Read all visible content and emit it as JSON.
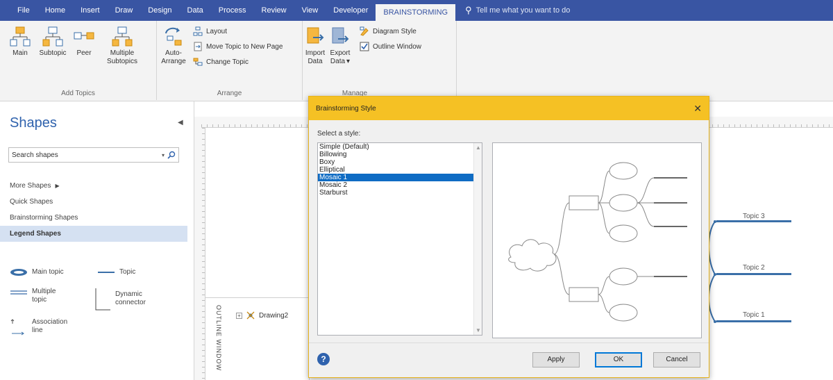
{
  "menubar": {
    "tabs": [
      {
        "label": "File",
        "active": false
      },
      {
        "label": "Home",
        "active": false
      },
      {
        "label": "Insert",
        "active": false
      },
      {
        "label": "Draw",
        "active": false
      },
      {
        "label": "Design",
        "active": false
      },
      {
        "label": "Data",
        "active": false
      },
      {
        "label": "Process",
        "active": false
      },
      {
        "label": "Review",
        "active": false
      },
      {
        "label": "View",
        "active": false
      },
      {
        "label": "Developer",
        "active": false
      },
      {
        "label": "BRAINSTORMING",
        "active": true
      }
    ],
    "tell_me": "Tell me what you want to do"
  },
  "ribbon": {
    "add_topics": {
      "label": "Add Topics",
      "main": "Main",
      "subtopic": "Subtopic",
      "peer": "Peer",
      "multiple_line1": "Multiple",
      "multiple_line2": "Subtopics"
    },
    "arrange": {
      "label": "Arrange",
      "auto_line1": "Auto-",
      "auto_line2": "Arrange",
      "layout": "Layout",
      "move_topic": "Move Topic to New Page",
      "change_topic": "Change Topic"
    },
    "manage": {
      "label": "Manage",
      "import_line1": "Import",
      "import_line2": "Data",
      "export_line1": "Export",
      "export_line2": "Data",
      "diagram_style": "Diagram Style",
      "outline_window": "Outline Window"
    }
  },
  "shapes_pane": {
    "title": "Shapes",
    "search_placeholder": "Search shapes",
    "items": [
      {
        "label": "More Shapes",
        "active": false
      },
      {
        "label": "Quick Shapes",
        "active": false
      },
      {
        "label": "Brainstorming Shapes",
        "active": false
      },
      {
        "label": "Legend Shapes",
        "active": true
      }
    ],
    "stencil": {
      "main_topic": "Main topic",
      "topic": "Topic",
      "multiple_topic_line1": "Multiple",
      "multiple_topic_line2": "topic",
      "dynamic_connector_line1": "Dynamic",
      "dynamic_connector_line2": "connector",
      "association_line1": "Association",
      "association_line2": "line"
    }
  },
  "outline_window": {
    "title": "OUTLINE WINDOW",
    "node": "Drawing2"
  },
  "page": {
    "topics": [
      "Topic 3",
      "Topic 2",
      "Topic 1"
    ]
  },
  "dialog": {
    "title": "Brainstorming Style",
    "select_label": "Select a style:",
    "styles": [
      "Simple (Default)",
      "Billowing",
      "Boxy",
      "Elliptical",
      "Mosaic 1",
      "Mosaic 2",
      "Starburst"
    ],
    "selected": "Mosaic 1",
    "buttons": {
      "apply": "Apply",
      "ok": "OK",
      "cancel": "Cancel"
    }
  },
  "colors": {
    "menubar": "#3955a3",
    "dialog_title": "#f5c124",
    "selection": "#0f6cc4",
    "topic_line": "#3a6fa8"
  }
}
